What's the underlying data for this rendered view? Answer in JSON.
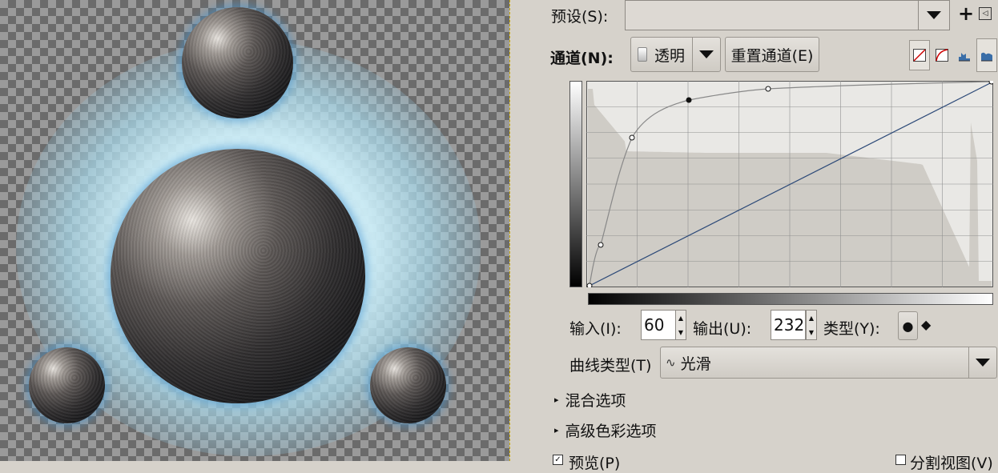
{
  "panel": {
    "preset_label": "预设(S):",
    "preset_value": "",
    "channel_label": "通道(N):",
    "channel_value": "透明",
    "reset_button": "重置通道(E)",
    "input_label": "输入(I):",
    "input_value": "60",
    "output_label": "输出(U):",
    "output_value": "232",
    "type_label": "类型(Y):",
    "curve_type_label": "曲线类型(T)",
    "curve_type_value": "光滑",
    "blend_options": "混合选项",
    "advanced_color": "高级色彩选项",
    "preview_label": "预览(P)",
    "split_view_label": "分割视图(V)"
  },
  "icons": {
    "add": "plus-icon",
    "manage": "panel-menu-icon",
    "linear_histogram": "linear-histogram-icon",
    "log_histogram": "log-histogram-icon",
    "curve_graph": "curve-graph-icon",
    "node_smooth": "smooth-node-icon",
    "node_corner": "corner-node-icon"
  },
  "colors": {
    "panel_bg": "#d6d2cb",
    "curve_line": "#2d4a78",
    "glow": "#cdeef8"
  }
}
